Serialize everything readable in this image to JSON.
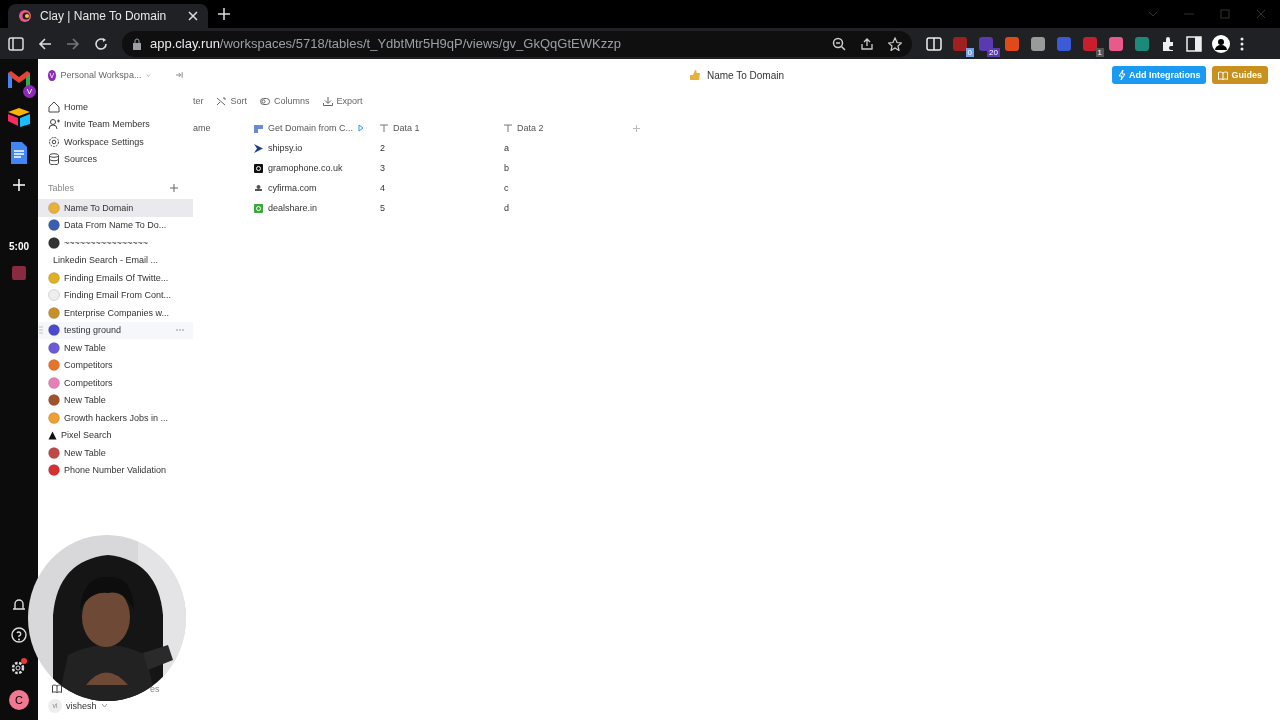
{
  "browser": {
    "tab_title": "Clay | Name To Domain",
    "url_host": "app.clay.run",
    "url_path": "/workspaces/5718/tables/t_YdbtMtr5H9qP/views/gv_GkQqGtEWKzzp",
    "extension_badges": [
      "0",
      "20",
      "1"
    ]
  },
  "dock": {
    "mail_badge": "V",
    "timer": "5:00",
    "avatar": "C"
  },
  "sidebar": {
    "workspace_avatar": "V",
    "workspace_name": "Personal Workspa...",
    "nav": [
      {
        "kind": "home",
        "label": "Home"
      },
      {
        "kind": "invite",
        "label": "Invite Team Members"
      },
      {
        "kind": "settings",
        "label": "Workspace Settings"
      },
      {
        "kind": "sources",
        "label": "Sources"
      }
    ],
    "tables_heading": "Tables",
    "tables": [
      {
        "label": "Name To Domain",
        "kind": "emoji",
        "color": "#e8b23a",
        "selected": true,
        "hovered": false
      },
      {
        "label": "Data From Name To Do...",
        "kind": "emoji",
        "color": "#3a5fb0",
        "selected": false,
        "hovered": false
      },
      {
        "label": "~~~~~~~~~~~~~~~~",
        "kind": "emoji",
        "color": "#333333",
        "selected": false,
        "hovered": false
      },
      {
        "label": "Linkedin Search - Email ...",
        "kind": "none",
        "selected": false,
        "hovered": false
      },
      {
        "label": "Finding Emails Of Twitte...",
        "kind": "emoji",
        "color": "#e0b020",
        "selected": false,
        "hovered": false
      },
      {
        "label": "Finding Email From Cont...",
        "kind": "emoji",
        "color": "#eeeeee",
        "selected": false,
        "hovered": false
      },
      {
        "label": "Enterprise Companies w...",
        "kind": "emoji",
        "color": "#c8902a",
        "selected": false,
        "hovered": false
      },
      {
        "label": "testing ground",
        "kind": "emoji",
        "color": "#4a4ad0",
        "selected": false,
        "hovered": true
      },
      {
        "label": "New Table",
        "kind": "emoji",
        "color": "#6a5ad8",
        "selected": false,
        "hovered": false
      },
      {
        "label": "Competitors",
        "kind": "emoji",
        "color": "#e8742a",
        "selected": false,
        "hovered": false
      },
      {
        "label": "Competitors",
        "kind": "emoji",
        "color": "#e880b8",
        "selected": false,
        "hovered": false
      },
      {
        "label": "New Table",
        "kind": "emoji",
        "color": "#a0522d",
        "selected": false,
        "hovered": false
      },
      {
        "label": "Growth hackers Jobs in ...",
        "kind": "emoji",
        "color": "#f0a030",
        "selected": false,
        "hovered": false
      },
      {
        "label": "Pixel Search",
        "kind": "triangle",
        "selected": false,
        "hovered": false
      },
      {
        "label": "New Table",
        "kind": "emoji",
        "color": "#c04848",
        "selected": false,
        "hovered": false
      },
      {
        "label": "Phone Number Validation",
        "kind": "emoji",
        "color": "#d83030",
        "selected": false,
        "hovered": false
      }
    ],
    "footer_label": "es",
    "user_avatar": "vi",
    "user_name": "vishesh"
  },
  "header": {
    "title": "Name To Domain",
    "buttons": [
      {
        "kind": "primary",
        "label": "Add Integrations"
      },
      {
        "kind": "secondary",
        "label": "Guides"
      }
    ]
  },
  "toolbar": [
    {
      "kind": "filter",
      "label": "ter"
    },
    {
      "kind": "sort",
      "label": "Sort"
    },
    {
      "kind": "columns",
      "label": "Columns"
    },
    {
      "kind": "export",
      "label": "Export"
    }
  ],
  "table": {
    "columns": [
      {
        "kind": "plain",
        "label": "ame"
      },
      {
        "kind": "enrichment",
        "label": "Get Domain from C..."
      },
      {
        "kind": "text",
        "label": "Data 1"
      },
      {
        "kind": "text",
        "label": "Data 2"
      }
    ],
    "rows": [
      {
        "kind": "chevron",
        "color": "#1f3a8a",
        "cells": [
          "",
          "shipsy.io",
          "2",
          "a"
        ]
      },
      {
        "kind": "square",
        "color": "#111111",
        "cells": [
          "",
          "gramophone.co.uk",
          "3",
          "b"
        ]
      },
      {
        "kind": "dot",
        "color": "#555555",
        "cells": [
          "",
          "cyfirma.com",
          "4",
          "c"
        ]
      },
      {
        "kind": "square",
        "color": "#3aa83a",
        "cells": [
          "",
          "dealshare.in",
          "5",
          "d"
        ]
      }
    ]
  }
}
